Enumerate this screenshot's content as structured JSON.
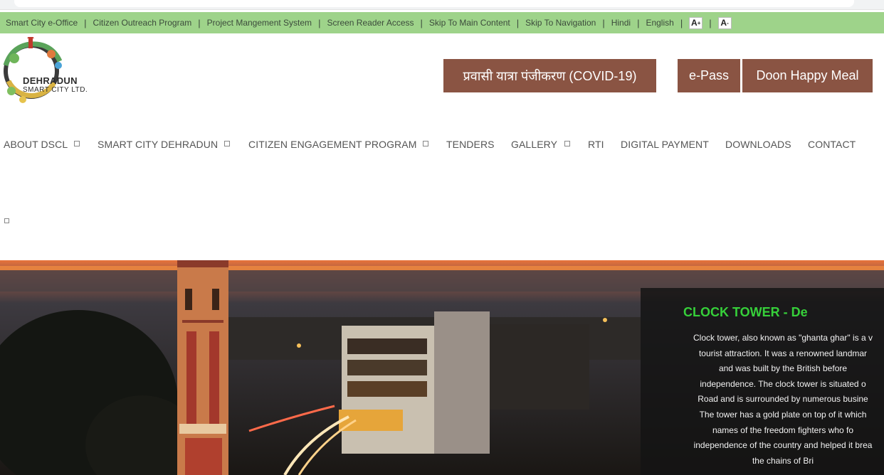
{
  "topbar": {
    "links": [
      "Smart City e-Office",
      "Citizen Outreach Program",
      "Project Mangement System",
      "Screen Reader Access",
      "Skip To Main Content",
      "Skip To Navigation",
      "Hindi",
      "English"
    ],
    "font_increase": "A",
    "font_decrease": "A"
  },
  "header": {
    "logo_title": "DEHRADUN",
    "logo_subtitle": "SMART CITY LTD.",
    "btn_registration": "प्रवासी यात्रा पंजीकरण (COVID-19)",
    "btn_epass": "e-Pass",
    "btn_meal": "Doon Happy Meal",
    "button_color": "#8a5443"
  },
  "nav": {
    "about": "ABOUT DSCL",
    "smart_city": "SMART CITY DEHRADUN",
    "citizen": "CITIZEN ENGAGEMENT PROGRAM",
    "tenders": "TENDERS",
    "gallery": "GALLERY",
    "rti": "RTI",
    "digital_payment": "DIGITAL PAYMENT",
    "downloads": "DOWNLOADS",
    "contact": "CONTACT"
  },
  "hero": {
    "title": "CLOCK TOWER - De",
    "lines": [
      "Clock tower, also known as \"ghanta ghar\" is a v",
      "tourist attraction. It was a renowned landmar",
      "and was built by the British before",
      "independence. The clock tower is situated o",
      "Road and is surrounded by numerous busine",
      "The tower has a gold plate on top of it which",
      "names of the freedom fighters who fo",
      "independence of the country and helped it brea",
      "the chains of Bri"
    ],
    "title_color": "#36d03a"
  },
  "colors": {
    "topbar": "#9ed38a",
    "accent": "#8a5443"
  }
}
